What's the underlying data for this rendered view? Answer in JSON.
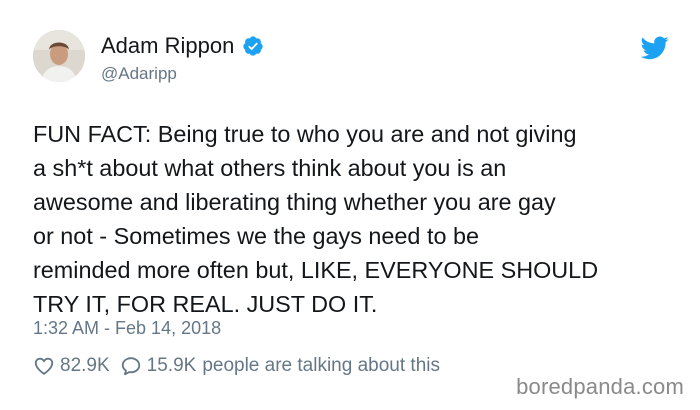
{
  "user": {
    "name": "Adam Rippon",
    "handle": "@Adaripp",
    "verified": true,
    "avatar_icon": "profile-photo"
  },
  "brand": {
    "icon": "twitter-bird-icon",
    "color": "#1da1f2"
  },
  "tweet": {
    "lines": [
      "FUN FACT: Being true to who you are and not giving",
      "a sh*t about what others think about you is an",
      "awesome and liberating thing whether you are gay",
      "or not - Sometimes we the gays need to be",
      "reminded more often but, LIKE, EVERYONE SHOULD",
      "TRY IT, FOR REAL. JUST DO IT."
    ]
  },
  "meta": {
    "timestamp": "1:32 AM - Feb 14, 2018"
  },
  "stats": {
    "likes": "82.9K",
    "replies": "15.9K",
    "talking_text": "people are talking about this"
  },
  "watermark": "boredpanda.com",
  "colors": {
    "text": "#14171a",
    "secondary": "#657786",
    "verified": "#1da1f2"
  }
}
